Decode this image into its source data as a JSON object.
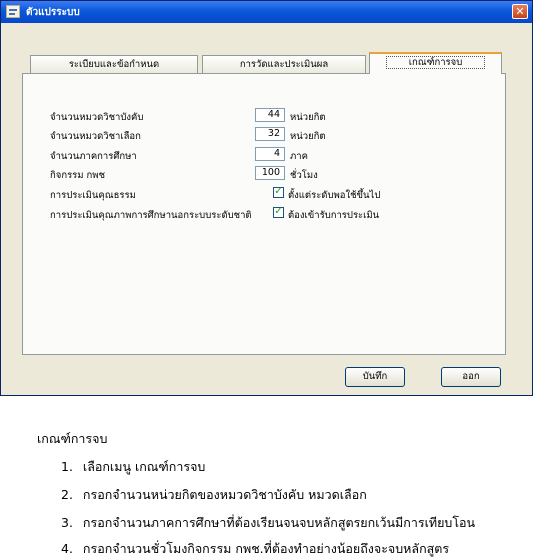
{
  "window": {
    "title": "ตัวแปรระบบ",
    "close_label": "✕"
  },
  "tabs": [
    {
      "label": "ระเบียบและข้อกำหนด"
    },
    {
      "label": "การวัดและประเมินผล"
    },
    {
      "label": "เกณฑ์การจบ"
    }
  ],
  "criteria": {
    "required_credits": {
      "label": "จำนวนหมวดวิชาบังคับ",
      "value": "44",
      "unit": "หน่วยกิต"
    },
    "elective_credits": {
      "label": "จำนวนหมวดวิชาเลือก",
      "value": "32",
      "unit": "หน่วยกิต"
    },
    "semesters": {
      "label": "จำนวนภาคการศึกษา",
      "value": "4",
      "unit": "ภาค"
    },
    "activity_hours": {
      "label": "กิจกรรม กพช",
      "value": "100",
      "unit": "ชั่วโมง"
    },
    "ethics": {
      "label": "การประเมินคุณธรรม",
      "checked": true,
      "option_label": "ตั้งแต่ระดับพอใช้ขึ้นไป"
    },
    "quality_assessment": {
      "label": "การประเมินคุณภาพการศึกษานอกระบบระดับชาติ",
      "checked": true,
      "option_label": "ต้องเข้ารับการประเมิน"
    }
  },
  "buttons": {
    "save_label": "บันทึก",
    "exit_label": "ออก"
  },
  "instructions": {
    "heading": "เกณฑ์การจบ",
    "steps": [
      {
        "num": "1.",
        "text": "เลือกเมนู เกณฑ์การจบ"
      },
      {
        "num": "2.",
        "text": "กรอกจำนวนหน่วยกิตของหมวดวิชาบังคับ หมวดเลือก"
      },
      {
        "num": "3.",
        "text": "กรอกจำนวนภาคการศึกษาที่ต้องเรียนจนจบหลักสูตรยกเว้นมีการเทียบโอน"
      },
      {
        "num": "4.",
        "text": "กรอกจำนวนชั่วโมงกิจกรรม กพช.ที่ต้องทำอย่างน้อยถึงจะจบหลักสูตร"
      }
    ]
  }
}
